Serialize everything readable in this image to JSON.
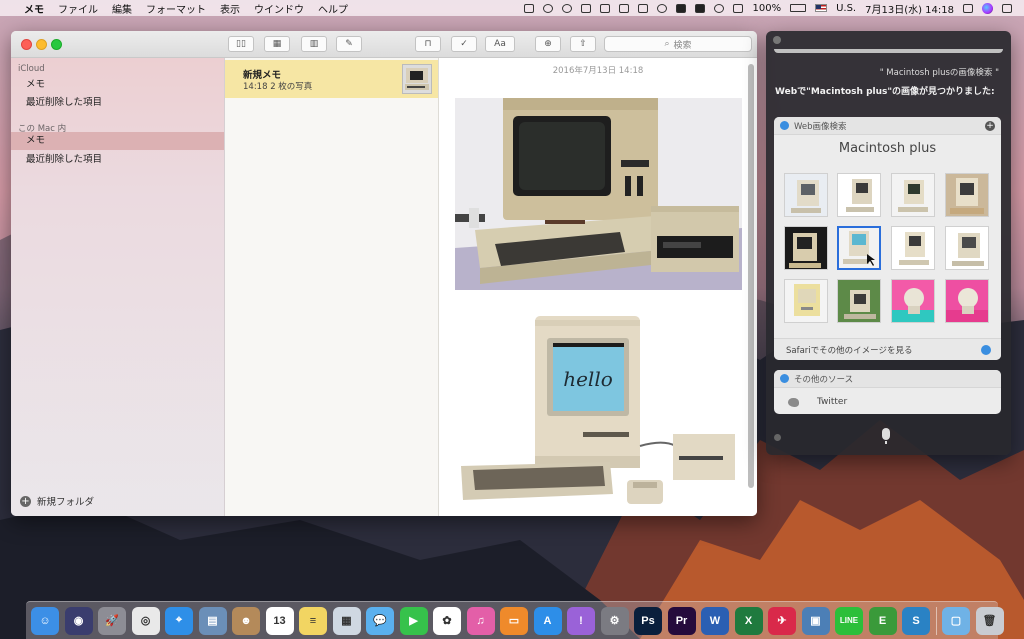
{
  "menubar": {
    "apple": "",
    "app_name": "メモ",
    "menus": [
      "ファイル",
      "編集",
      "フォーマット",
      "表示",
      "ウインドウ",
      "ヘルプ"
    ],
    "battery": "100%",
    "input_source": "U.S.",
    "clock": "7月13日(水)  14:18"
  },
  "notes": {
    "search_placeholder": "検索",
    "sidebar": {
      "icloud_header": "iCloud",
      "icloud_items": [
        "メモ",
        "最近削除した項目"
      ],
      "mac_header": "この Mac 内",
      "mac_items": [
        "メモ",
        "最近削除した項目"
      ],
      "new_folder": "新規フォルダ"
    },
    "note": {
      "title": "新規メモ",
      "subtitle": "14:18   2 枚の写真"
    },
    "editor": {
      "date": "2016年7月13日 14:18"
    },
    "toolbar": {
      "format_label": "Aa"
    },
    "photo2_text": "hello"
  },
  "siri": {
    "query": "\" Macintosh plusの画像検索 \"",
    "answer": "Webで\"Macintosh plus\"の画像が見つかりました:",
    "web_card": {
      "header": "Web画像検索",
      "title": "Macintosh plus",
      "footer": "Safariでその他のイメージを見る"
    },
    "other_card": {
      "header": "その他のソース",
      "item": "Twitter"
    }
  },
  "dock": {
    "items": [
      {
        "name": "finder-icon",
        "color": "#3c8fe6",
        "glyph": "☺"
      },
      {
        "name": "siri-icon",
        "color": "#3a3d6e",
        "glyph": "◉"
      },
      {
        "name": "launchpad-icon",
        "color": "#8d8d95",
        "glyph": "🚀"
      },
      {
        "name": "chrome-icon",
        "color": "#e9e9e9",
        "glyph": "◎"
      },
      {
        "name": "safari-icon",
        "color": "#2e8fe8",
        "glyph": "⌖"
      },
      {
        "name": "preview-icon",
        "color": "#6b8fb8",
        "glyph": "▤"
      },
      {
        "name": "contacts-icon",
        "color": "#b48a5a",
        "glyph": "☻"
      },
      {
        "name": "calendar-icon",
        "color": "#ffffff",
        "glyph": "13"
      },
      {
        "name": "notes-icon",
        "color": "#f2d562",
        "glyph": "≡"
      },
      {
        "name": "photobooth-icon",
        "color": "#cfd8e2",
        "glyph": "▦"
      },
      {
        "name": "messages-icon",
        "color": "#5ab0ee",
        "glyph": "💬"
      },
      {
        "name": "facetime-icon",
        "color": "#36c24b",
        "glyph": "▶"
      },
      {
        "name": "photos-icon",
        "color": "#ffffff",
        "glyph": "✿"
      },
      {
        "name": "itunes-icon",
        "color": "#e35fa8",
        "glyph": "♫"
      },
      {
        "name": "ibooks-icon",
        "color": "#ef8a2b",
        "glyph": "▭"
      },
      {
        "name": "appstore-icon",
        "color": "#2d8ee8",
        "glyph": "A"
      },
      {
        "name": "feedback-icon",
        "color": "#9a62d8",
        "glyph": "!"
      },
      {
        "name": "system-preferences-icon",
        "color": "#7b7b82",
        "glyph": "⚙"
      },
      {
        "name": "photoshop-icon",
        "color": "#0a1f3c",
        "glyph": "Ps"
      },
      {
        "name": "premiere-icon",
        "color": "#250b3c",
        "glyph": "Pr"
      },
      {
        "name": "word-icon",
        "color": "#2b5fb3",
        "glyph": "W"
      },
      {
        "name": "excel-icon",
        "color": "#1f7a3e",
        "glyph": "X"
      },
      {
        "name": "airmail-icon",
        "color": "#d9294a",
        "glyph": "✈"
      },
      {
        "name": "file-save-icon",
        "color": "#4c7fb6",
        "glyph": "▣"
      },
      {
        "name": "line-icon",
        "color": "#2cbf3a",
        "glyph": "LINE"
      },
      {
        "name": "evernote-icon",
        "color": "#3a9a3a",
        "glyph": "E"
      },
      {
        "name": "sophos-icon",
        "color": "#2a82c4",
        "glyph": "S"
      },
      {
        "name": "downloads-folder-icon",
        "color": "#6fb2e6",
        "glyph": "▢"
      },
      {
        "name": "trash-icon",
        "color": "#c9ccd2",
        "glyph": "🗑"
      }
    ]
  }
}
